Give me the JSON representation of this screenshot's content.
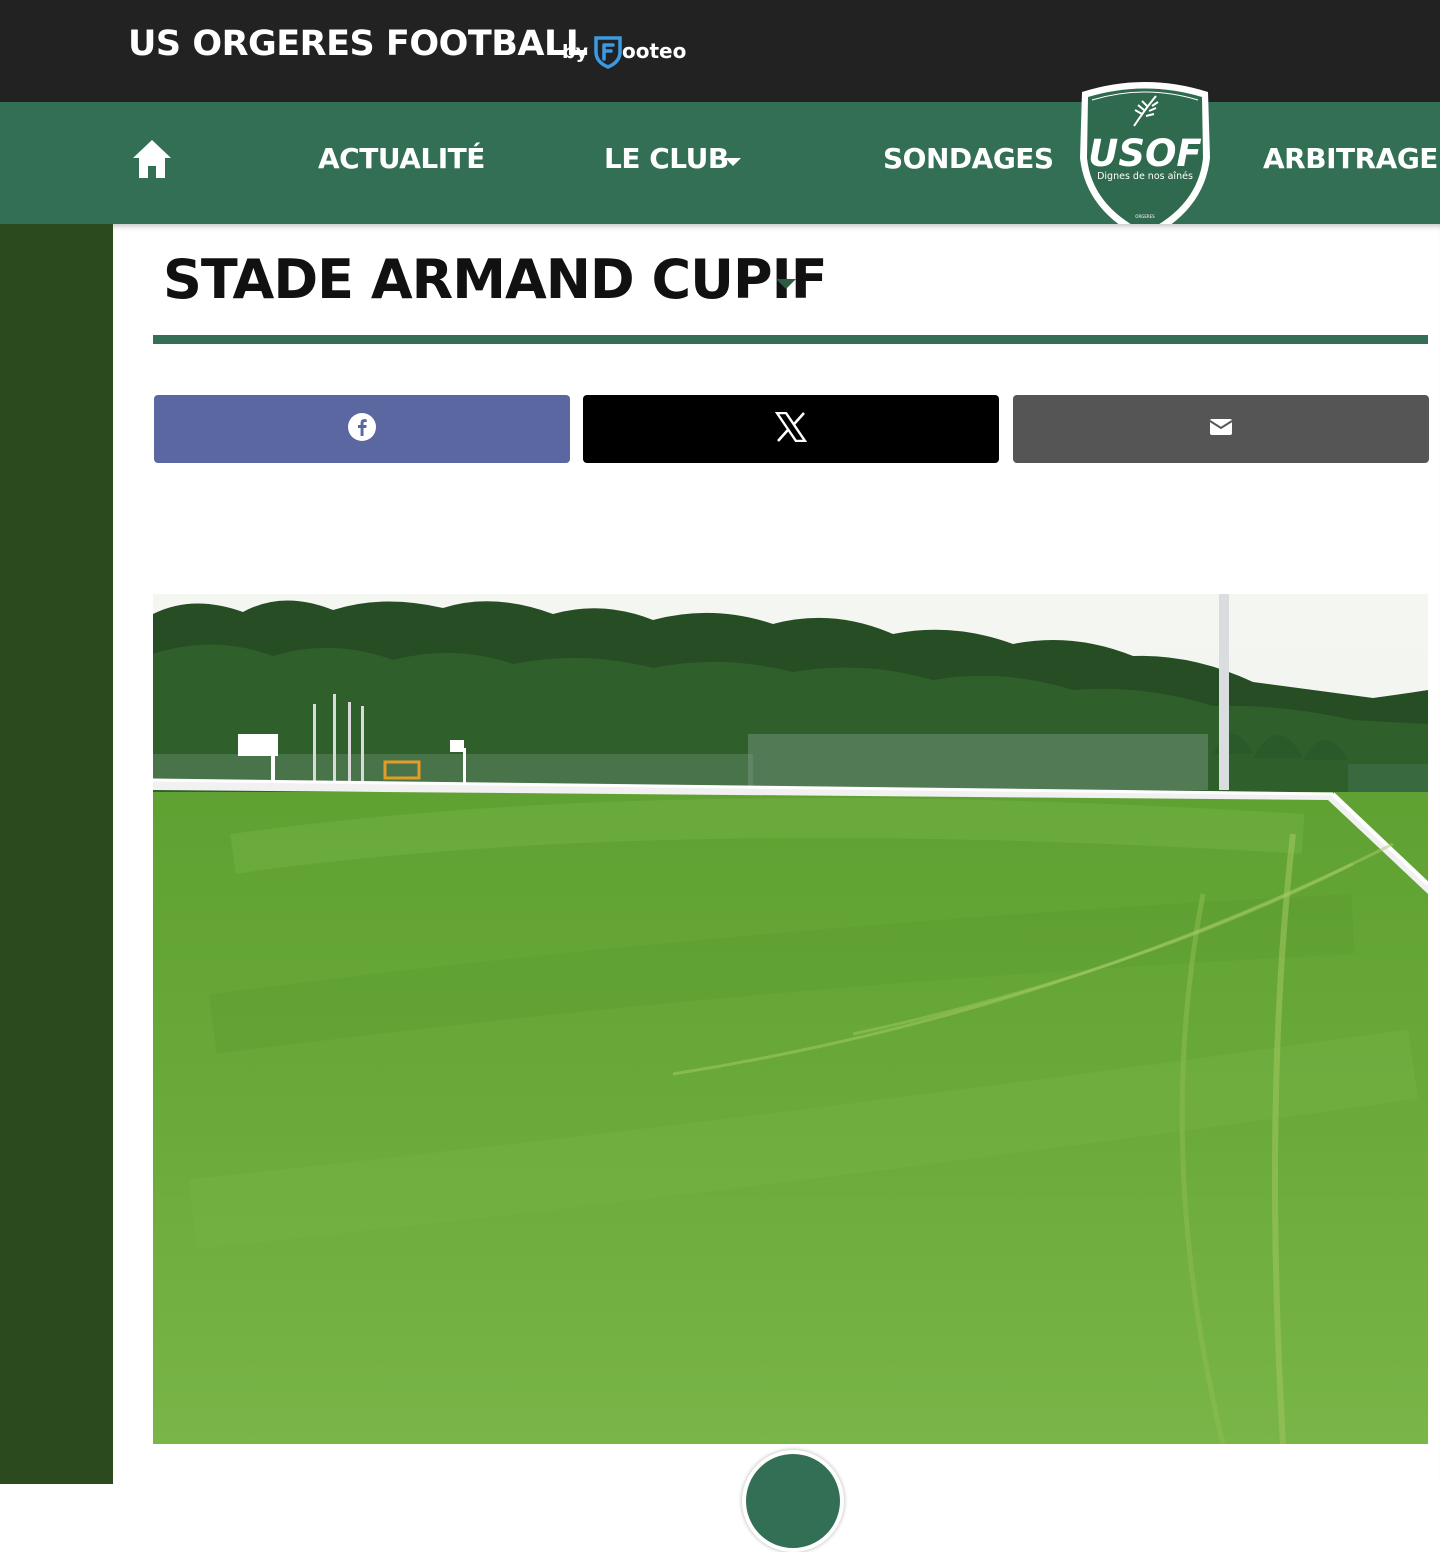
{
  "header": {
    "site_title": "US ORGERES FOOTBALL",
    "by_label": "by",
    "brand_name": "ooteo",
    "brand_icon": "footeo-shield-icon"
  },
  "nav": {
    "home_icon": "home-icon",
    "items": [
      {
        "label": "ACTUALITÉ",
        "has_dropdown": false
      },
      {
        "label": "LE CLUB",
        "has_dropdown": true
      },
      {
        "label": "SONDAGES",
        "has_dropdown": false
      },
      {
        "label": "ARBITRAGE ET",
        "has_dropdown": false
      }
    ],
    "logo": {
      "initials": "USOF",
      "motto": "Dignes de nos aînés",
      "small_text": "ORGERES"
    }
  },
  "page": {
    "title": "STADE ARMAND CUPIF"
  },
  "share": {
    "facebook_icon": "facebook-icon",
    "x_icon": "x-icon",
    "mail_icon": "mail-icon"
  },
  "colors": {
    "topbar": "#222222",
    "nav_green": "#336f55",
    "side_green": "#2b4b1f",
    "facebook": "#5a67a0",
    "x": "#000000",
    "mail": "#555555"
  }
}
